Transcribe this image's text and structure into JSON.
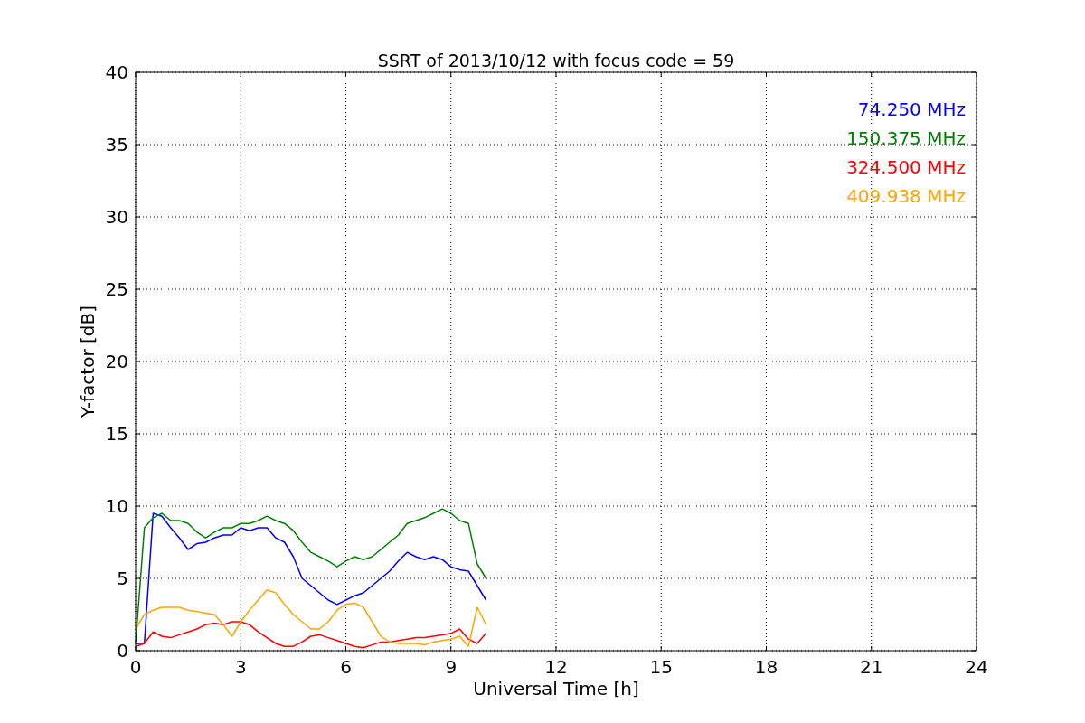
{
  "chart_data": {
    "type": "line",
    "title": "SSRT of 2013/10/12 with focus code = 59",
    "xlabel": "Universal Time [h]",
    "ylabel": "Y-factor [dB]",
    "x": [
      0,
      0.25,
      0.5,
      0.75,
      1,
      1.25,
      1.5,
      1.75,
      2,
      2.25,
      2.5,
      2.75,
      3,
      3.25,
      3.5,
      3.75,
      4,
      4.25,
      4.5,
      4.75,
      5,
      5.25,
      5.5,
      5.75,
      6,
      6.25,
      6.5,
      6.75,
      7,
      7.25,
      7.5,
      7.75,
      8,
      8.25,
      8.5,
      8.75,
      9,
      9.25,
      9.5,
      9.75,
      10
    ],
    "series": [
      {
        "name": "74.250 MHz",
        "color": "#0000ff",
        "values": [
          0.5,
          0.5,
          9.5,
          9.3,
          8.5,
          7.8,
          7,
          7.4,
          7.5,
          7.8,
          8,
          8,
          8.5,
          8.3,
          8.5,
          8.5,
          7.8,
          7.5,
          6.5,
          5,
          4.5,
          4,
          3.5,
          3.2,
          3.5,
          3.8,
          4,
          4.5,
          5,
          5.5,
          6.2,
          6.8,
          6.5,
          6.3,
          6.5,
          6.3,
          5.8,
          5.6,
          5.5,
          4.5,
          3.5
        ]
      },
      {
        "name": "150.375 MHz",
        "color": "#008000",
        "values": [
          0.5,
          8.5,
          9.2,
          9.5,
          9,
          9,
          8.8,
          8.2,
          7.8,
          8.2,
          8.5,
          8.5,
          8.8,
          8.8,
          9,
          9.3,
          9,
          8.8,
          8.3,
          7.5,
          6.8,
          6.5,
          6.2,
          5.8,
          6.2,
          6.5,
          6.3,
          6.5,
          7,
          7.5,
          8,
          8.8,
          9,
          9.2,
          9.5,
          9.8,
          9.5,
          9,
          8.8,
          6,
          5
        ]
      },
      {
        "name": "324.500 MHz",
        "color": "#ff0000",
        "values": [
          0.3,
          0.5,
          1.3,
          1,
          0.9,
          1.1,
          1.3,
          1.5,
          1.8,
          1.9,
          1.8,
          2,
          2,
          1.8,
          1.3,
          0.9,
          0.5,
          0.3,
          0.3,
          0.6,
          1,
          1.1,
          0.9,
          0.7,
          0.5,
          0.3,
          0.2,
          0.4,
          0.6,
          0.6,
          0.7,
          0.8,
          0.9,
          0.9,
          1,
          1.1,
          1.2,
          1.5,
          0.8,
          0.5,
          1.2
        ]
      },
      {
        "name": "409.938 MHz",
        "color": "#ffa500",
        "values": [
          1.5,
          2.5,
          2.8,
          3,
          3,
          3,
          2.8,
          2.7,
          2.6,
          2.5,
          1.8,
          1,
          2,
          2.8,
          3.5,
          4.2,
          4,
          3.2,
          2.5,
          2,
          1.5,
          1.5,
          2,
          2.8,
          3.2,
          3.3,
          3,
          2,
          1,
          0.6,
          0.5,
          0.5,
          0.5,
          0.4,
          0.6,
          0.7,
          0.8,
          1,
          0.3,
          3,
          1.8
        ]
      }
    ],
    "grid": true,
    "xlim": [
      0,
      24
    ],
    "ylim": [
      0,
      40
    ],
    "xticks": [
      0,
      3,
      6,
      9,
      12,
      15,
      18,
      21,
      24
    ],
    "yticks": [
      0,
      5,
      10,
      15,
      20,
      25,
      30,
      35,
      40
    ]
  }
}
